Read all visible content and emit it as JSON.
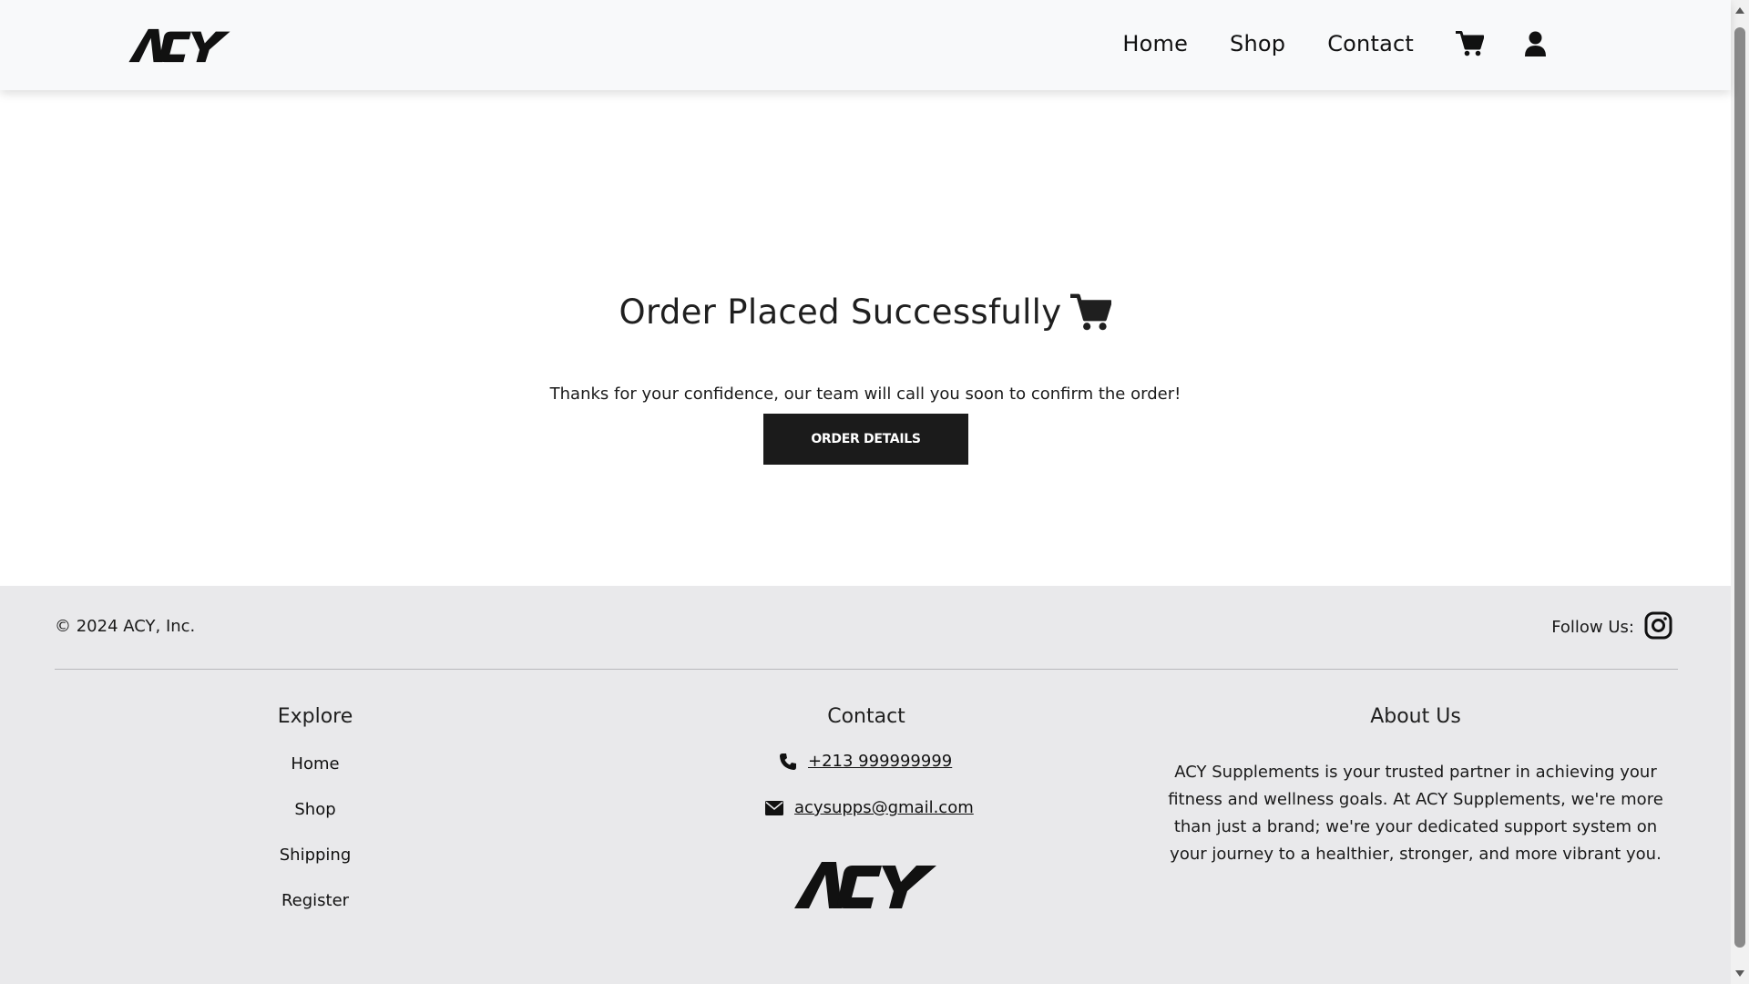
{
  "header": {
    "logo_text": "ACY",
    "nav": {
      "home": "Home",
      "shop": "Shop",
      "contact": "Contact"
    },
    "icons": [
      "cart-icon",
      "user-icon"
    ]
  },
  "main": {
    "title": "Order Placed Successfully",
    "title_icon": "cart-icon",
    "message": "Thanks for your confidence, our team will call you soon to confirm the order!",
    "button_label": "ORDER DETAILS"
  },
  "footer": {
    "copyright": "© 2024 ACY, Inc.",
    "follow_label": "Follow Us:",
    "follow_icon": "instagram-icon",
    "explore": {
      "title": "Explore",
      "links": [
        "Home",
        "Shop",
        "Shipping",
        "Register"
      ]
    },
    "contact": {
      "title": "Contact",
      "phone": "+213 999999999",
      "email": "acysupps@gmail.com"
    },
    "about": {
      "title": "About Us",
      "text": "ACY Supplements is your trusted partner in achieving your fitness and wellness goals. At ACY Supplements, we're more than just a brand; we're your dedicated support system on your journey to a healthier, stronger, and more vibrant you."
    },
    "logo_text": "ACY"
  },
  "colors": {
    "header_bg": "#f8f9fa",
    "footer_bg": "#e9e9eb",
    "button_bg": "#1b1b1b",
    "text": "#1c1c1c"
  }
}
